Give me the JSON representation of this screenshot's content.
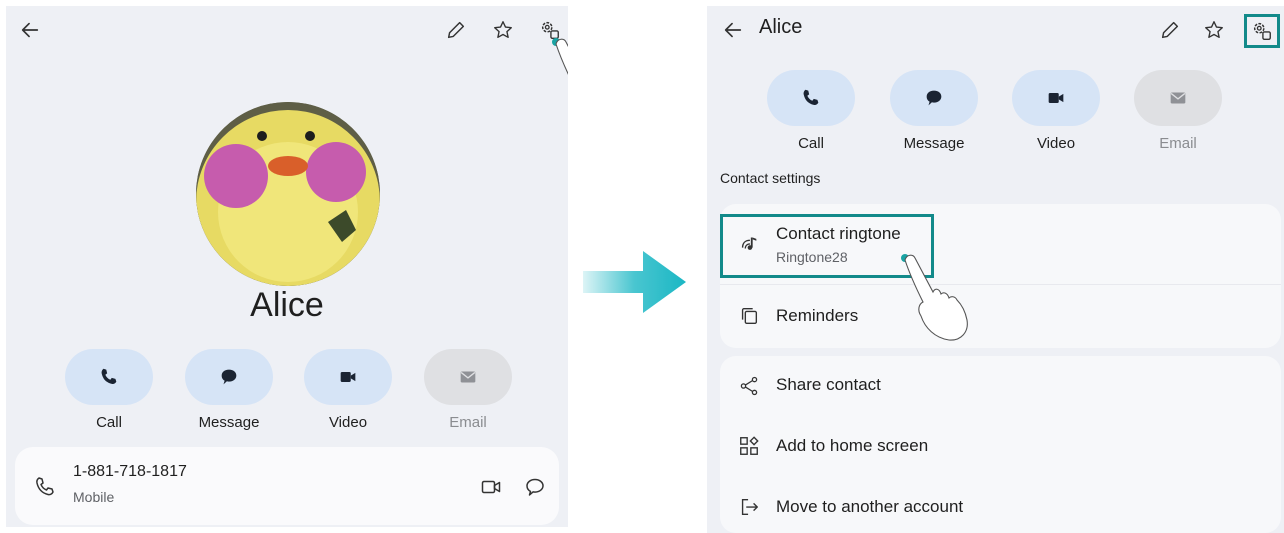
{
  "left": {
    "contact_name": "Alice",
    "actions": [
      {
        "label": "Call",
        "enabled": true
      },
      {
        "label": "Message",
        "enabled": true
      },
      {
        "label": "Video",
        "enabled": true
      },
      {
        "label": "Email",
        "enabled": false
      }
    ],
    "phone": {
      "number": "1-881-718-1817",
      "type": "Mobile"
    }
  },
  "right": {
    "title": "Alice",
    "actions": [
      {
        "label": "Call",
        "enabled": true
      },
      {
        "label": "Message",
        "enabled": true
      },
      {
        "label": "Video",
        "enabled": true
      },
      {
        "label": "Email",
        "enabled": false
      }
    ],
    "section_title": "Contact settings",
    "ringtone": {
      "title": "Contact ringtone",
      "value": "Ringtone28"
    },
    "reminders": "Reminders",
    "share": "Share contact",
    "add_home": "Add to home screen",
    "move_account": "Move to another account"
  },
  "colors": {
    "accent": "#128a8a",
    "arrow": "#1bb7c4",
    "panel_bg": "#eef0f5",
    "pill_bg": "#d6e4f6",
    "pill_disabled": "#dfe0e3"
  },
  "icons": [
    "back-arrow-icon",
    "pencil-icon",
    "star-icon",
    "settings-icon",
    "phone-icon",
    "message-icon",
    "video-icon",
    "email-icon",
    "ringtone-icon",
    "reminders-icon",
    "share-icon",
    "add-home-icon",
    "move-account-icon"
  ]
}
